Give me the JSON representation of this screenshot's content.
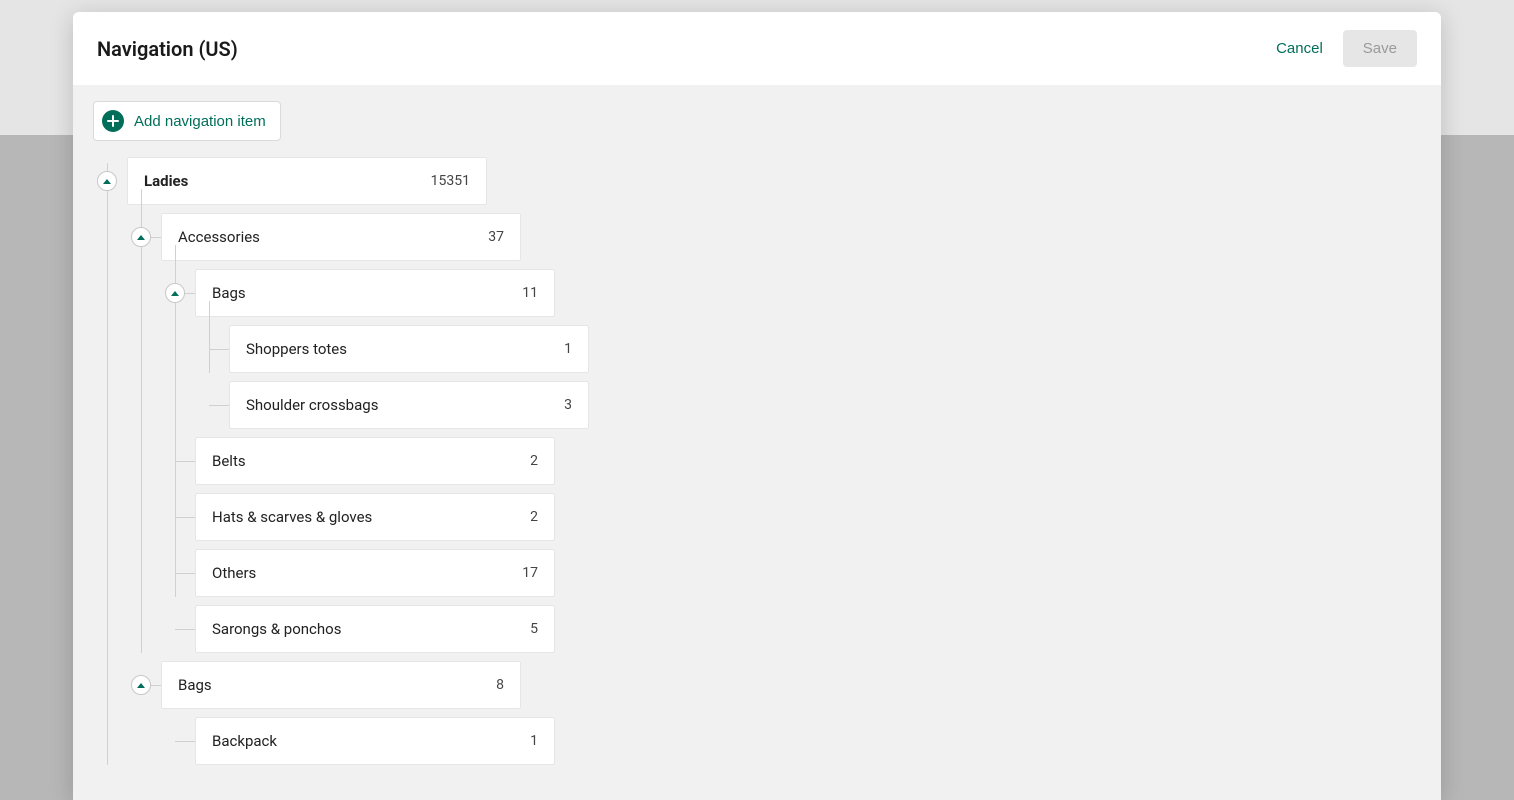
{
  "modal": {
    "title": "Navigation (US)",
    "cancel_label": "Cancel",
    "save_label": "Save",
    "add_label": "Add navigation item"
  },
  "tree": {
    "ladies": {
      "label": "Ladies",
      "count": "15351"
    },
    "accessories": {
      "label": "Accessories",
      "count": "37"
    },
    "bags1": {
      "label": "Bags",
      "count": "11"
    },
    "shoppers": {
      "label": "Shoppers totes",
      "count": "1"
    },
    "shoulder": {
      "label": "Shoulder crossbags",
      "count": "3"
    },
    "belts": {
      "label": "Belts",
      "count": "2"
    },
    "hats": {
      "label": "Hats & scarves & gloves",
      "count": "2"
    },
    "others": {
      "label": "Others",
      "count": "17"
    },
    "sarongs": {
      "label": "Sarongs & ponchos",
      "count": "5"
    },
    "bags2": {
      "label": "Bags",
      "count": "8"
    },
    "backpack": {
      "label": "Backpack",
      "count": "1"
    }
  }
}
